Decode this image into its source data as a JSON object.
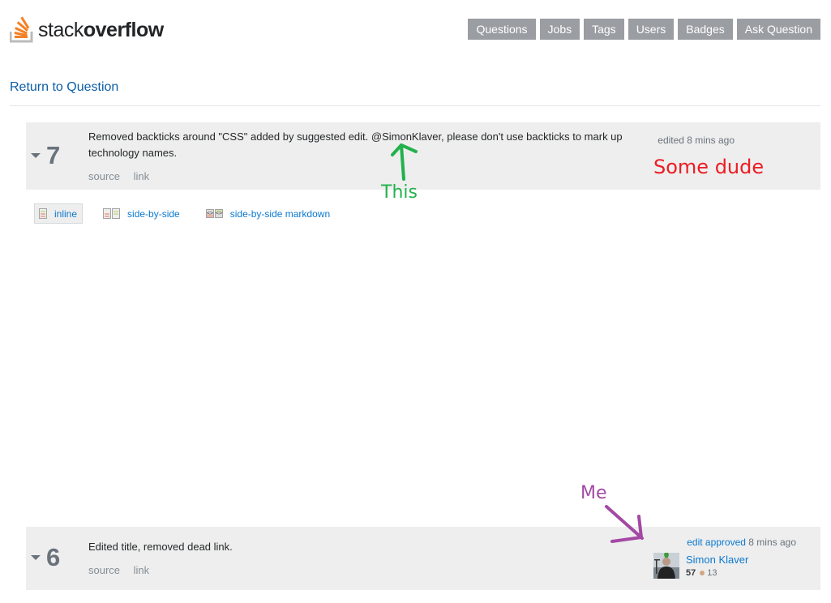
{
  "header": {
    "logo": {
      "light": "stack",
      "bold": "overflow"
    },
    "nav": [
      "Questions",
      "Jobs",
      "Tags",
      "Users",
      "Badges",
      "Ask Question"
    ]
  },
  "return_link": "Return to Question",
  "revisions": [
    {
      "number": "7",
      "comment": "Removed backticks around \"CSS\" added by suggested edit. @SimonKlaver, please don't use backticks to mark up technology names.",
      "links": [
        "source",
        "link"
      ],
      "edited": "edited 8 mins ago"
    },
    {
      "number": "6",
      "comment": "Edited title, removed dead link.",
      "links": [
        "source",
        "link"
      ],
      "approved_link": "edit approved",
      "approved_time": "8 mins ago",
      "user": {
        "name": "Simon Klaver",
        "reputation": "57",
        "bronze": "13"
      }
    }
  ],
  "views": [
    {
      "label": "inline",
      "active": true
    },
    {
      "label": "side-by-side",
      "active": false
    },
    {
      "label": "side-by-side markdown",
      "active": false
    }
  ],
  "annotations": {
    "this": "This",
    "some_dude": "Some dude",
    "me": "Me",
    "colors": {
      "green": "#22b14c",
      "red": "#ed1c24",
      "purple": "#a349a4"
    }
  },
  "colors": {
    "nav_bg": "#9a9ea3",
    "link": "#0c79cf",
    "brand_orange": "#f48024",
    "rev_bg": "#eeeeee"
  }
}
